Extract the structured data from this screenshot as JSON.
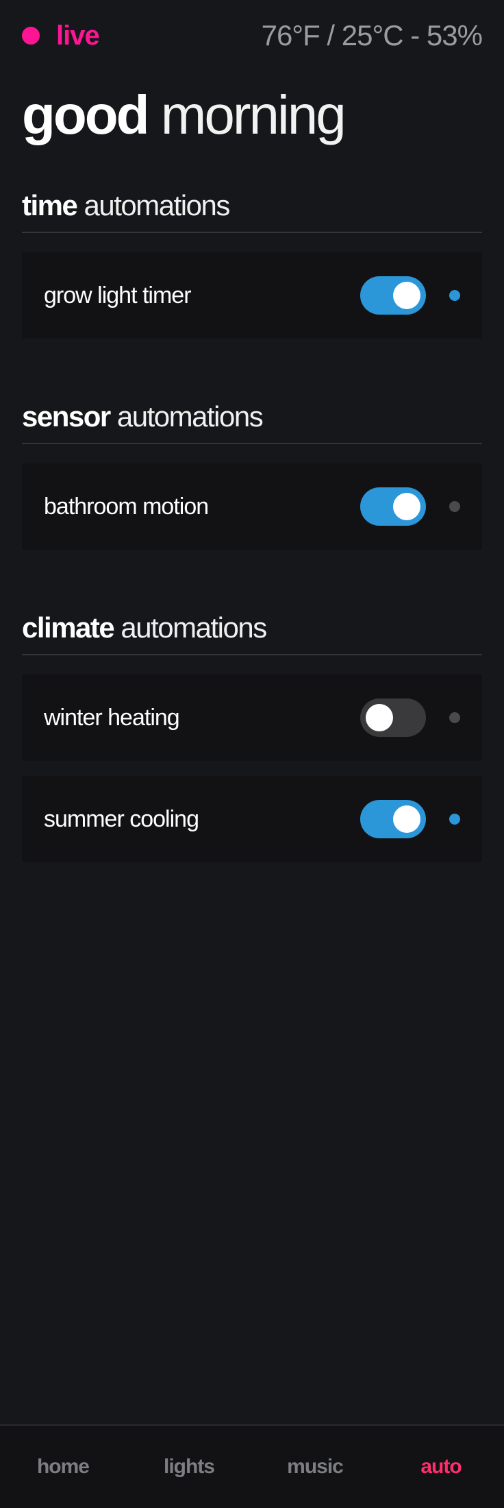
{
  "header": {
    "live_label": "live",
    "live_color": "#ff1493",
    "climate_readout": "76°F / 25°C - 53%"
  },
  "greeting": {
    "bold": "good",
    "light": "morning"
  },
  "sections": [
    {
      "title_bold": "time",
      "title_light": "automations",
      "items": [
        {
          "label": "grow light timer",
          "enabled": true,
          "status_color": "#2b96d8"
        }
      ]
    },
    {
      "title_bold": "sensor",
      "title_light": "automations",
      "items": [
        {
          "label": "bathroom motion",
          "enabled": true,
          "status_color": "#4a4a4c"
        }
      ]
    },
    {
      "title_bold": "climate",
      "title_light": "automations",
      "items": [
        {
          "label": "winter heating",
          "enabled": false,
          "status_color": "#4a4a4c"
        },
        {
          "label": "summer cooling",
          "enabled": true,
          "status_color": "#2b96d8"
        }
      ]
    }
  ],
  "nav": {
    "items": [
      "home",
      "lights",
      "music",
      "auto"
    ],
    "active": "auto",
    "active_color": "#ff2d6b"
  },
  "colors": {
    "background": "#16171a",
    "card": "#121214",
    "toggle_on": "#2b96d8",
    "toggle_off": "#3a3a3c"
  }
}
